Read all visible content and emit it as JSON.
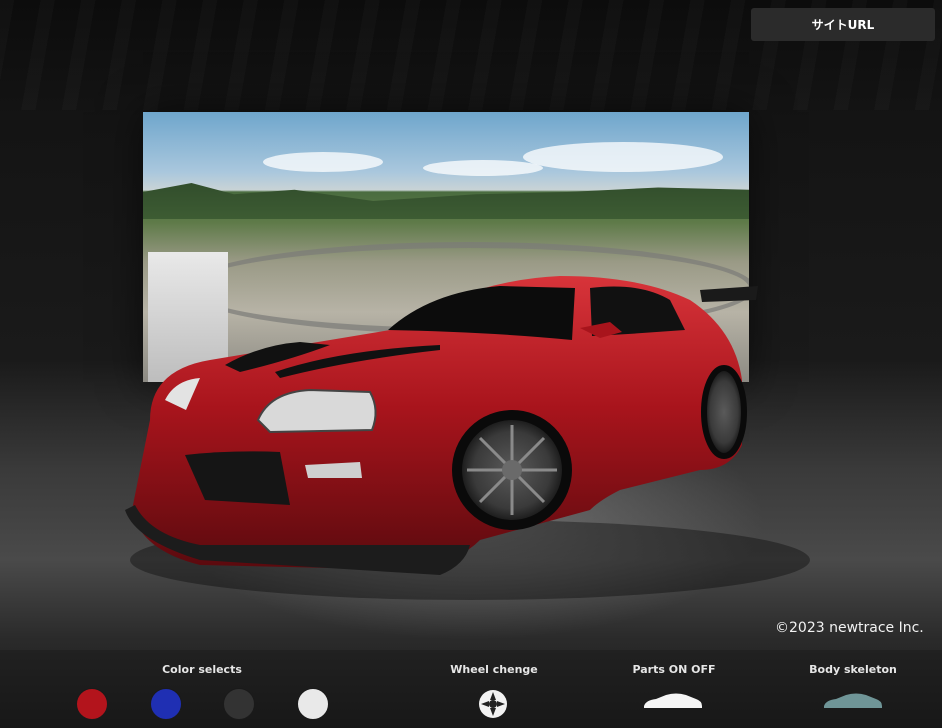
{
  "header": {
    "site_button_label": "サイトURL"
  },
  "footer": {
    "copyright": "©2023 newtrace Inc."
  },
  "controls": {
    "color_selects_label": "Color selects",
    "wheel_change_label": "Wheel chenge",
    "parts_label": "Parts ON OFF",
    "body_skeleton_label": "Body skeleton",
    "colors": [
      "#b3141c",
      "#1f2fb3",
      "#333333",
      "#e9e9e9"
    ]
  },
  "icons": {
    "wheel": "wheel-icon",
    "parts": "car-silhouette-icon",
    "skeleton": "car-skeleton-icon"
  }
}
